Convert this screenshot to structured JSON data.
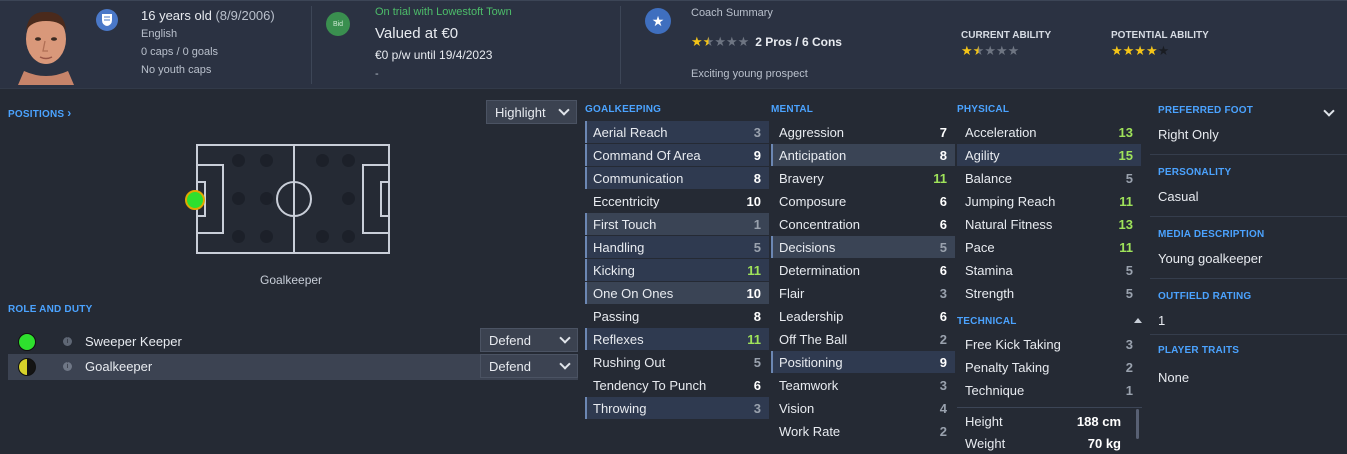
{
  "header": {
    "age_text": "16 years old",
    "dob": "(8/9/2006)",
    "nationality": "English",
    "caps": "0 caps / 0 goals",
    "youth_caps": "No youth caps",
    "bid_icon_label": "Bid",
    "trial_status": "On trial with Lowestoft Town",
    "value": "Valued at €0",
    "wage": "€0 p/w until 19/4/2023",
    "dash": "-",
    "coach_summary_title": "Coach Summary",
    "pros_cons": "2 Pros / 6 Cons",
    "prospect_text": "Exciting young prospect",
    "current_ability_label": "CURRENT ABILITY",
    "potential_ability_label": "POTENTIAL ABILITY",
    "coach_stars": 1.5,
    "current_ability_stars": 1.5,
    "potential_ability_stars": 4.0
  },
  "positions": {
    "title": "POSITIONS",
    "chevron": "›",
    "highlight_label": "Highlight",
    "position_name": "Goalkeeper",
    "active_position": "GK",
    "active_color": "#2ee02e"
  },
  "roles": {
    "title": "ROLE AND DUTY",
    "items": [
      {
        "name": "Sweeper Keeper",
        "duty": "Defend",
        "info": "i"
      },
      {
        "name": "Goalkeeper",
        "duty": "Defend",
        "info": "i"
      }
    ]
  },
  "goalkeeping": {
    "title": "GOALKEEPING",
    "rows": [
      {
        "label": "Aerial Reach",
        "value": "3"
      },
      {
        "label": "Command Of Area",
        "value": "9"
      },
      {
        "label": "Communication",
        "value": "8"
      },
      {
        "label": "Eccentricity",
        "value": "10"
      },
      {
        "label": "First Touch",
        "value": "1"
      },
      {
        "label": "Handling",
        "value": "5"
      },
      {
        "label": "Kicking",
        "value": "11"
      },
      {
        "label": "One On Ones",
        "value": "10"
      },
      {
        "label": "Passing",
        "value": "8"
      },
      {
        "label": "Reflexes",
        "value": "11"
      },
      {
        "label": "Rushing Out",
        "value": "5"
      },
      {
        "label": "Tendency To Punch",
        "value": "6"
      },
      {
        "label": "Throwing",
        "value": "3"
      }
    ]
  },
  "mental": {
    "title": "MENTAL",
    "rows": [
      {
        "label": "Aggression",
        "value": "7"
      },
      {
        "label": "Anticipation",
        "value": "8"
      },
      {
        "label": "Bravery",
        "value": "11"
      },
      {
        "label": "Composure",
        "value": "6"
      },
      {
        "label": "Concentration",
        "value": "6"
      },
      {
        "label": "Decisions",
        "value": "5"
      },
      {
        "label": "Determination",
        "value": "6"
      },
      {
        "label": "Flair",
        "value": "3"
      },
      {
        "label": "Leadership",
        "value": "6"
      },
      {
        "label": "Off The Ball",
        "value": "2"
      },
      {
        "label": "Positioning",
        "value": "9"
      },
      {
        "label": "Teamwork",
        "value": "3"
      },
      {
        "label": "Vision",
        "value": "4"
      },
      {
        "label": "Work Rate",
        "value": "2"
      }
    ]
  },
  "physical": {
    "title": "PHYSICAL",
    "rows": [
      {
        "label": "Acceleration",
        "value": "13"
      },
      {
        "label": "Agility",
        "value": "15"
      },
      {
        "label": "Balance",
        "value": "5"
      },
      {
        "label": "Jumping Reach",
        "value": "11"
      },
      {
        "label": "Natural Fitness",
        "value": "13"
      },
      {
        "label": "Pace",
        "value": "11"
      },
      {
        "label": "Stamina",
        "value": "5"
      },
      {
        "label": "Strength",
        "value": "5"
      }
    ]
  },
  "technical": {
    "title": "TECHNICAL",
    "rows": [
      {
        "label": "Free Kick Taking",
        "value": "3"
      },
      {
        "label": "Penalty Taking",
        "value": "2"
      },
      {
        "label": "Technique",
        "value": "1"
      }
    ]
  },
  "body": {
    "height_label": "Height",
    "height_value": "188 cm",
    "weight_label": "Weight",
    "weight_value": "70 kg"
  },
  "info": {
    "preferred_foot_label": "PREFERRED FOOT",
    "preferred_foot": "Right Only",
    "personality_label": "PERSONALITY",
    "personality": "Casual",
    "media_label": "MEDIA DESCRIPTION",
    "media": "Young goalkeeper",
    "outfield_label": "OUTFIELD RATING",
    "outfield": "1",
    "traits_label": "PLAYER TRAITS",
    "traits": "None"
  },
  "colors": {
    "accent_blue": "#4ba3ff",
    "green_value": "#9fe35a",
    "trial_green": "#4dbd6a",
    "star_gold": "#f5c518"
  }
}
